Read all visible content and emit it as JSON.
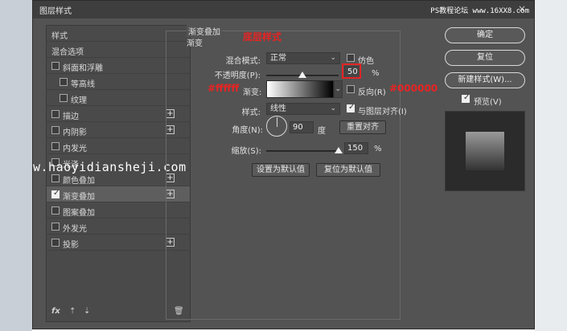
{
  "watermark_top": "PS教程论坛 www.16XX8.com",
  "watermark_mid": "w.haoyidiansheji.com",
  "dialog": {
    "title": "图层样式",
    "close_icon": "×"
  },
  "styles_list": {
    "items": [
      {
        "label": "样式",
        "checkbox": false,
        "checked": false,
        "plus": false,
        "selected": false,
        "indent": 0
      },
      {
        "label": "混合选项",
        "checkbox": false,
        "checked": false,
        "plus": false,
        "selected": false,
        "indent": 0
      },
      {
        "label": "斜面和浮雕",
        "checkbox": true,
        "checked": false,
        "plus": false,
        "selected": false,
        "indent": 0
      },
      {
        "label": "等高线",
        "checkbox": true,
        "checked": false,
        "plus": false,
        "selected": false,
        "indent": 1
      },
      {
        "label": "纹理",
        "checkbox": true,
        "checked": false,
        "plus": false,
        "selected": false,
        "indent": 1
      },
      {
        "label": "描边",
        "checkbox": true,
        "checked": false,
        "plus": true,
        "selected": false,
        "indent": 0
      },
      {
        "label": "内阴影",
        "checkbox": true,
        "checked": false,
        "plus": true,
        "selected": false,
        "indent": 0
      },
      {
        "label": "内发光",
        "checkbox": true,
        "checked": false,
        "plus": false,
        "selected": false,
        "indent": 0
      },
      {
        "label": "光泽",
        "checkbox": true,
        "checked": false,
        "plus": false,
        "selected": false,
        "indent": 0
      },
      {
        "label": "颜色叠加",
        "checkbox": true,
        "checked": false,
        "plus": true,
        "selected": false,
        "indent": 0
      },
      {
        "label": "渐变叠加",
        "checkbox": true,
        "checked": true,
        "plus": true,
        "selected": true,
        "indent": 0
      },
      {
        "label": "图案叠加",
        "checkbox": true,
        "checked": false,
        "plus": false,
        "selected": false,
        "indent": 0
      },
      {
        "label": "外发光",
        "checkbox": true,
        "checked": false,
        "plus": false,
        "selected": false,
        "indent": 0
      },
      {
        "label": "投影",
        "checkbox": true,
        "checked": false,
        "plus": true,
        "selected": false,
        "indent": 0
      }
    ],
    "plus_symbol": "+",
    "footer": {
      "fx": "fx",
      "up_arrow": "⇡",
      "down_arrow": "⇣",
      "trash": "🗑"
    }
  },
  "gradient_overlay": {
    "group_title": "渐变叠加",
    "subgroup_title": "渐变",
    "blend_mode_label": "混合模式:",
    "blend_mode_value": "正常",
    "dither_label": "仿色",
    "opacity_label": "不透明度(P):",
    "opacity_value": "50",
    "opacity_unit": "%",
    "opacity_level": 50,
    "gradient_label": "渐变:",
    "reverse_label": "反向(R)",
    "style_label": "样式:",
    "style_value": "线性",
    "align_label": "与图层对齐(I)",
    "angle_label": "角度(N):",
    "angle_value": "90",
    "angle_unit": "度",
    "reset_align_button": "重置对齐",
    "scale_label": "缩放(S):",
    "scale_value": "150",
    "scale_unit": "%",
    "scale_level": 100,
    "make_default_button": "设置为默认值",
    "reset_default_button": "复位为默认值"
  },
  "annotations": {
    "title_note": "底层样式",
    "left_color": "#ffffff",
    "right_color": "#000000"
  },
  "right_panel": {
    "ok_button": "确定",
    "reset_button": "复位",
    "new_style_button": "新建样式(W)...",
    "preview_label": "预览(V)"
  },
  "colors": {
    "dialog_bg": "#535353",
    "annotation_red": "#e62424"
  }
}
